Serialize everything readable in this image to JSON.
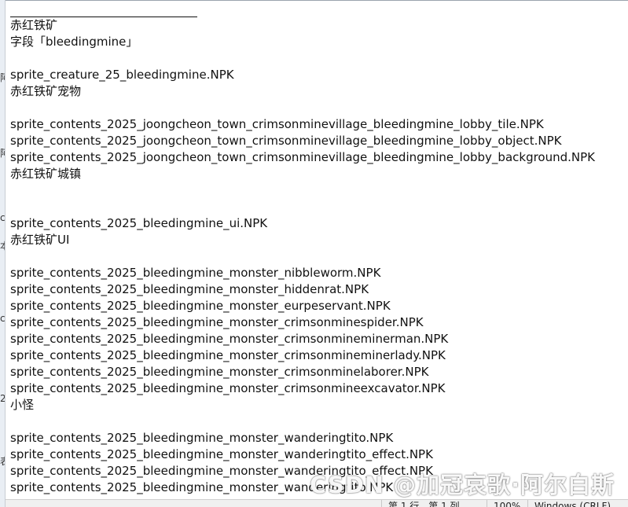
{
  "window": {
    "left_strip_fragments": [
      "阿",
      "阿",
      "c",
      "本",
      "c",
      "2",
      "表"
    ]
  },
  "editor": {
    "lines": [
      "",
      "赤红铁矿",
      "字段「bleedingmine」",
      "",
      "sprite_creature_25_bleedingmine.NPK",
      "赤红铁矿宠物",
      "",
      "sprite_contents_2025_joongcheon_town_crimsonminevillage_bleedingmine_lobby_tile.NPK",
      "sprite_contents_2025_joongcheon_town_crimsonminevillage_bleedingmine_lobby_object.NPK",
      "sprite_contents_2025_joongcheon_town_crimsonminevillage_bleedingmine_lobby_background.NPK",
      "赤红铁矿城镇",
      "",
      "",
      "sprite_contents_2025_bleedingmine_ui.NPK",
      "赤红铁矿UI",
      "",
      "sprite_contents_2025_bleedingmine_monster_nibbleworm.NPK",
      "sprite_contents_2025_bleedingmine_monster_hiddenrat.NPK",
      "sprite_contents_2025_bleedingmine_monster_eurpeservant.NPK",
      "sprite_contents_2025_bleedingmine_monster_crimsonminespider.NPK",
      "sprite_contents_2025_bleedingmine_monster_crimsonmineminerman.NPK",
      "sprite_contents_2025_bleedingmine_monster_crimsonmineminerlady.NPK",
      "sprite_contents_2025_bleedingmine_monster_crimsonminelaborer.NPK",
      "sprite_contents_2025_bleedingmine_monster_crimsonmineexcavator.NPK",
      "小怪",
      "",
      "sprite_contents_2025_bleedingmine_monster_wanderingtito.NPK",
      "sprite_contents_2025_bleedingmine_monster_wanderingtito_effect.NPK",
      "sprite_contents_2025_bleedingmine_monster_wanderingtito_effect.NPK",
      "sprite_contents_2025_bleedingmine_monster_wanderingtito.NPK"
    ]
  },
  "status_bar": {
    "position": "第 1 行，第 1 列",
    "zoom": "100%",
    "line_ending": "Windows (CRLF)"
  },
  "watermark": {
    "text": "CSDN @加冠哀歌·阿尔白斯"
  }
}
